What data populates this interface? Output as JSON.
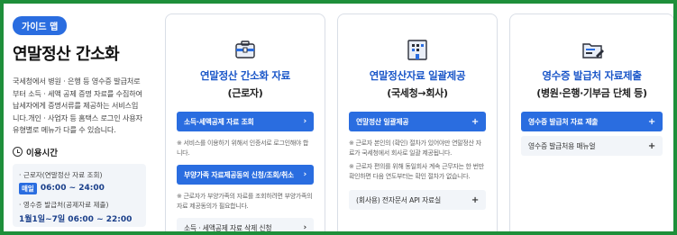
{
  "left": {
    "badge": "가이드 맵",
    "title": "연말정산 간소화",
    "description": "국세청에서 병원 · 은행 등 영수증 발급처로부터 소득 · 세액 공제 증명 자료를 수집하여 납세자에게 증명서류를 제공하는 서비스입니다.개인 · 사업자 등 홈택스 로그인 사용자 유형별로 메뉴가 다를 수 있습니다.",
    "usage_title": "이용시간",
    "usage": [
      {
        "label": "· 근로자(연말정산 자료 조회)",
        "badge": "매일",
        "time": "06:00 ~ 24:00"
      },
      {
        "label": "· 영수증 발급처(공제자료 제출)",
        "badge": "",
        "time": "1월1일~7일 06:00 ~ 22:00"
      }
    ]
  },
  "card1": {
    "icon": "briefcase-icon",
    "title": "연말정산 간소화 자료",
    "subtitle": "(근로자)",
    "btn1": "소득·세액공제 자료 조회",
    "note1": "※ 서비스를 이용하기 위해서 인증서로 로그인해야 합니다.",
    "btn2": "부양가족 자료제공동의 신청/조회/취소",
    "note2": "※ 근로자가 부양가족의 자료를 조회하려면 부양가족의 자료 제공동의가 필요합니다.",
    "btn3": "소득 · 세액공제 자료 삭제 신청"
  },
  "card2": {
    "icon": "building-icon",
    "title": "연말정산자료 일괄제공",
    "subtitle": "(국세청→회사)",
    "btn1": "연말정산 일괄제공",
    "note1": "※ 근로자 본인의 (확인) 절차가 있어야만 연말정산 자료가 국세청에서 회사로 일괄 제공됩니다.",
    "note2": "※ 근로자 편의를 위해 동일회사 계속 근무자는 한 번만 확인하면 다음 연도부터는 확인 절차가 없습니다.",
    "btn2": "(회사용) 전자문서 API 자료실"
  },
  "card3": {
    "icon": "folder-pen-icon",
    "title": "영수증 발급처 자료제출",
    "subtitle": "(병원·은행·기부금 단체 등)",
    "btn1": "영수증 발급처 자료 제출",
    "btn2": "영수증 발급처용 매뉴얼"
  },
  "symbols": {
    "arrow": "›",
    "plus": "+"
  },
  "colors": {
    "frame": "#1e8f3a",
    "accent": "#2a6de0",
    "title_blue": "#1a56c8"
  }
}
